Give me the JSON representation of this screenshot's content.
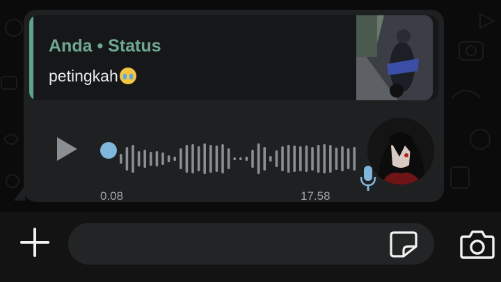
{
  "reply": {
    "title": "Anda • Status",
    "text": "petingkah"
  },
  "voice": {
    "current_time": "0.08",
    "total_time": "17.58",
    "progress": 0.005
  },
  "composer": {
    "placeholder": ""
  },
  "colors": {
    "accent_green": "#6fa891",
    "voice_blue": "#7fb6dc",
    "bubble": "#1f2021",
    "background": "#0b0b0b"
  },
  "icons": {
    "play": "play-icon",
    "mic": "microphone-icon",
    "plus": "plus-icon",
    "sticker": "sticker-icon",
    "camera": "camera-icon",
    "emoji": "crying-face-emoji"
  }
}
